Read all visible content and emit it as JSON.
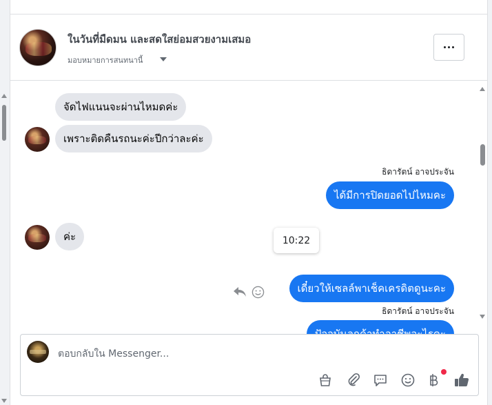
{
  "header": {
    "title": "ในวันที่มืดมน และสดใสย่อมสวยงามเสมอ",
    "assignment_label": "มอบหมายการสนทนานี้"
  },
  "messages": {
    "m1": "จัดไฟแนนจะผ่านไหมดค่ะ",
    "m2": "เพราะติดคืนรถนะค่ะปีกว่าละค่ะ",
    "sender1": "ธิดารัตน์ อาจประจัน",
    "m3": "ได้มีการปิดยอดไปไหมคะ",
    "m4": "ค่ะ",
    "tooltip_time": "10:22",
    "m5": "เดี๋ยวให้เซลล์พาเช็คเครดิตดูนะคะ",
    "sender2": "ธิดารัตน์ อาจประจัน",
    "m6": "ปัจจุบันลูกค้าทำอาชีพอะไรคะ"
  },
  "composer": {
    "placeholder": "ตอบกลับใน Messenger...",
    "tools": [
      "shopping-bag-icon",
      "paperclip-icon",
      "chat-bubble-icon",
      "emoji-icon",
      "baht-icon",
      "thumbs-up-icon"
    ]
  },
  "colors": {
    "accent": "#1877f2",
    "incoming_bubble": "#e4e6eb",
    "notification": "#f02849"
  }
}
